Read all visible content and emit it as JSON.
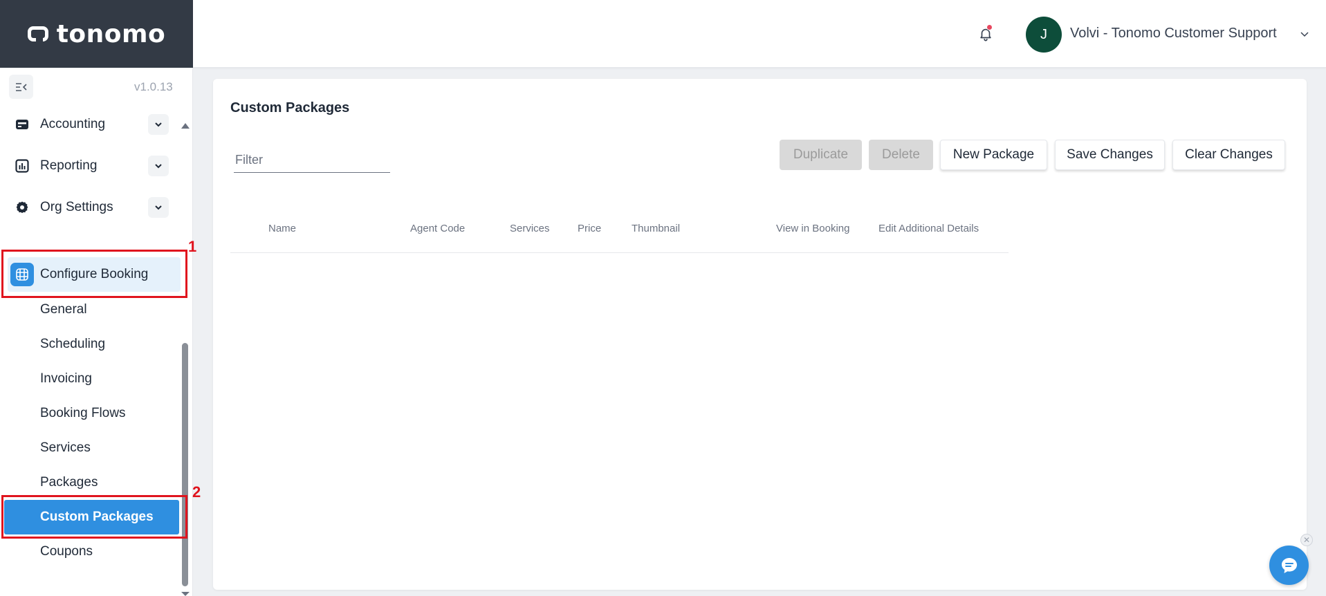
{
  "app": {
    "logo_text": "tonomo",
    "version": "v1.0.13"
  },
  "header": {
    "avatar_initial": "J",
    "user_name": "Volvi - Tonomo Customer Support"
  },
  "sidebar": {
    "items": [
      {
        "label": "Accounting",
        "icon": "wallet-icon"
      },
      {
        "label": "Reporting",
        "icon": "chart-icon"
      },
      {
        "label": "Org Settings",
        "icon": "gear-icon"
      }
    ],
    "configure_booking": {
      "label": "Configure Booking",
      "icon": "booking-grid-icon"
    },
    "sub_items": [
      "General",
      "Scheduling",
      "Invoicing",
      "Booking Flows",
      "Services",
      "Packages",
      "Custom Packages",
      "Coupons"
    ],
    "active_sub_item": "Custom Packages"
  },
  "annotations": [
    "1",
    "2"
  ],
  "main": {
    "title": "Custom Packages",
    "filter_placeholder": "Filter",
    "buttons": {
      "duplicate": "Duplicate",
      "delete": "Delete",
      "new_package": "New Package",
      "save_changes": "Save Changes",
      "clear_changes": "Clear Changes"
    },
    "columns": [
      "Name",
      "Agent Code",
      "Services",
      "Price",
      "Thumbnail",
      "View in Booking",
      "Edit Additional Details"
    ]
  },
  "colors": {
    "accent": "#2f8fe0",
    "annotation": "#e0141e",
    "logo_bar": "#333a45",
    "avatar": "#0d4d3a"
  }
}
